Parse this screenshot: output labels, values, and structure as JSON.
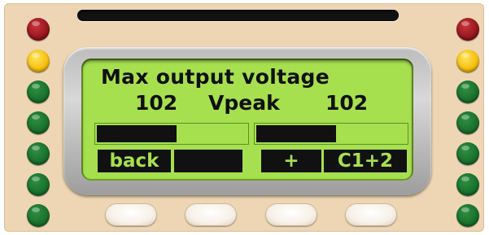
{
  "display": {
    "title": "Max output voltage",
    "value_left": "102",
    "unit": "Vpeak",
    "value_right": "102",
    "bar_left_level": 0.53,
    "bar_right_level": 0.53
  },
  "softkeys": [
    "back",
    "",
    "+",
    "C1+2"
  ],
  "leds": {
    "left": [
      "red",
      "yellow",
      "green",
      "green",
      "green",
      "green",
      "green"
    ],
    "right": [
      "red",
      "yellow",
      "green",
      "green",
      "green",
      "green",
      "green"
    ]
  },
  "colors": {
    "panel": "#eed6b4",
    "lcd": "#a6e04f",
    "lcd_text": "#101010"
  }
}
